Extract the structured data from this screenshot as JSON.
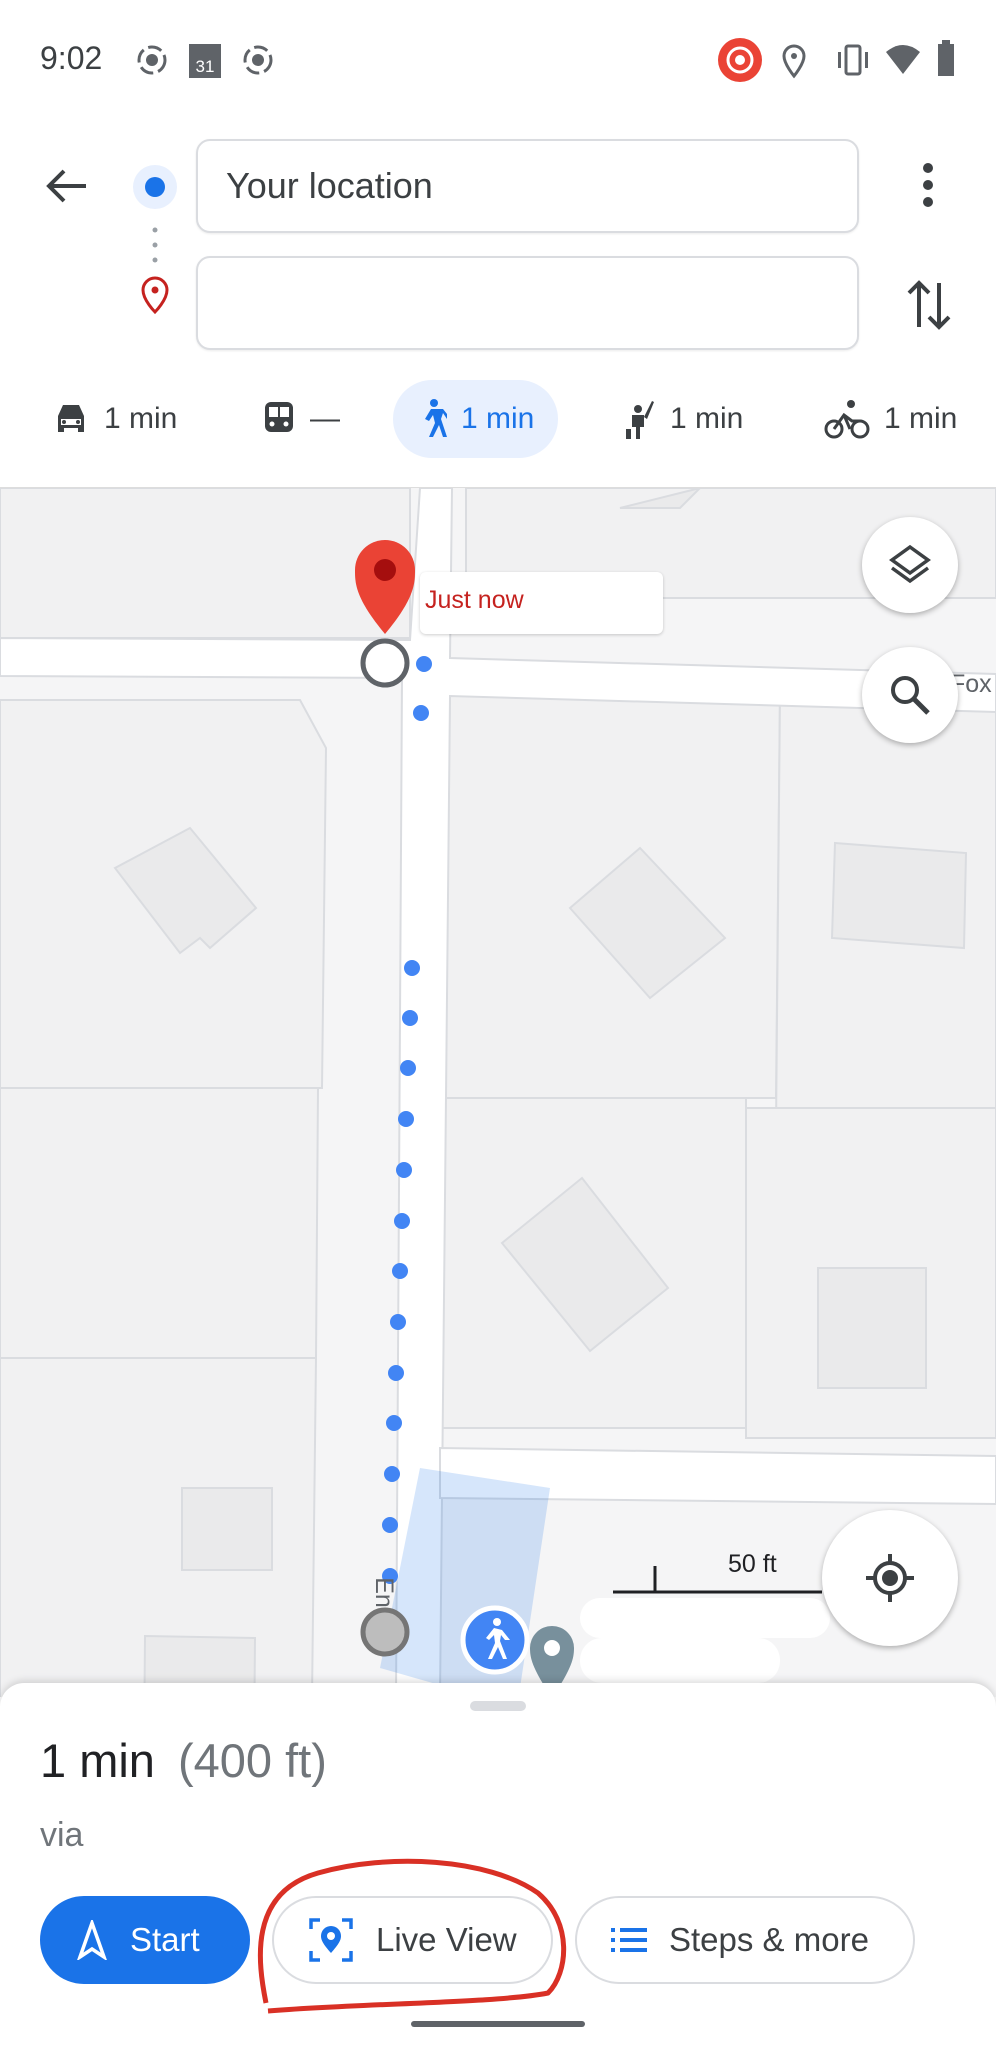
{
  "status_bar": {
    "time": "9:02",
    "calendar_day": "31",
    "icons": [
      "screen-record-icon",
      "calendar-icon",
      "screen-record-icon",
      "record-active-icon",
      "location-icon",
      "vibrate-icon",
      "wifi-icon",
      "battery-icon"
    ]
  },
  "header": {
    "origin_value": "Your location",
    "destination_value": "",
    "destination_placeholder": ""
  },
  "modes": [
    {
      "icon": "car-icon",
      "label": "1 min"
    },
    {
      "icon": "train-icon",
      "label": "—"
    },
    {
      "icon": "walk-icon",
      "label": "1 min",
      "selected": true
    },
    {
      "icon": "ride-hail-icon",
      "label": "1 min"
    },
    {
      "icon": "bike-icon",
      "label": "1 min"
    }
  ],
  "map": {
    "bubble": "Just now",
    "street_right": "Fox",
    "street_vertical": "En",
    "scale": "50 ft"
  },
  "sheet": {
    "duration": "1 min",
    "distance": "(400 ft)",
    "via": "via",
    "start": "Start",
    "live_view": "Live View",
    "steps": "Steps & more"
  },
  "colors": {
    "accent": "#1a73e8",
    "pin": "#ea4335",
    "annotation": "#d93025"
  }
}
